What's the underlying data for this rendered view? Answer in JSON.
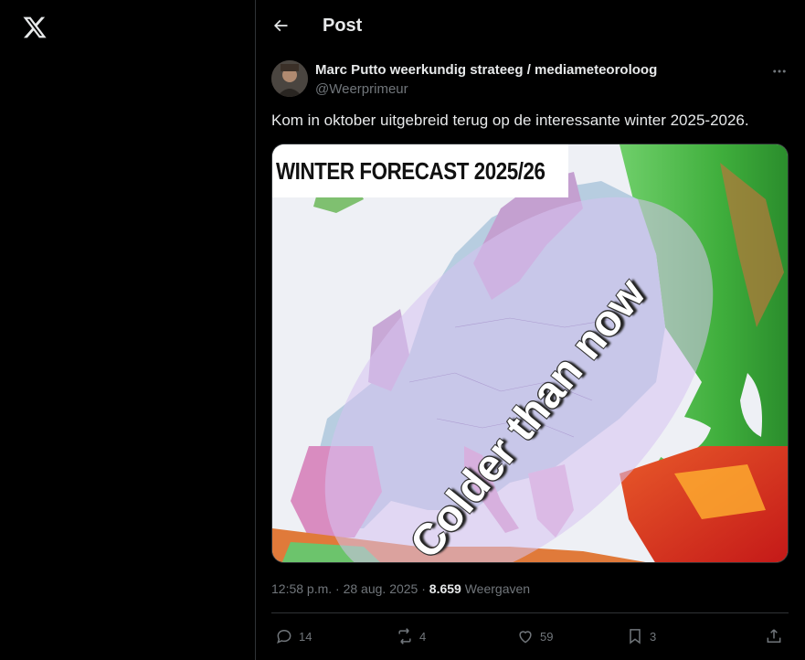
{
  "header": {
    "title": "Post",
    "back_icon": "arrow-left-icon"
  },
  "brand": {
    "logo": "x-logo-icon"
  },
  "post": {
    "author_name": "Marc Putto weerkundig strateeg / mediameteoroloog",
    "author_handle": "@Weerprimeur",
    "text": "Kom in oktober uitgebreid terug op de interessante winter 2025-2026.",
    "media": {
      "banner_text": "WINTER FORECAST 2025/26",
      "overlay_text": "Colder than now"
    },
    "timestamp": "12:58 p.m. · 28 aug. 2025 · ",
    "views_count": "8.659",
    "views_label": " Weergaven",
    "actions": {
      "replies": "14",
      "reposts": "4",
      "likes": "59",
      "bookmarks": "3"
    }
  },
  "colors": {
    "background": "#000000",
    "text_primary": "#e7e9ea",
    "text_secondary": "#71767b",
    "divider": "#2f3336"
  }
}
